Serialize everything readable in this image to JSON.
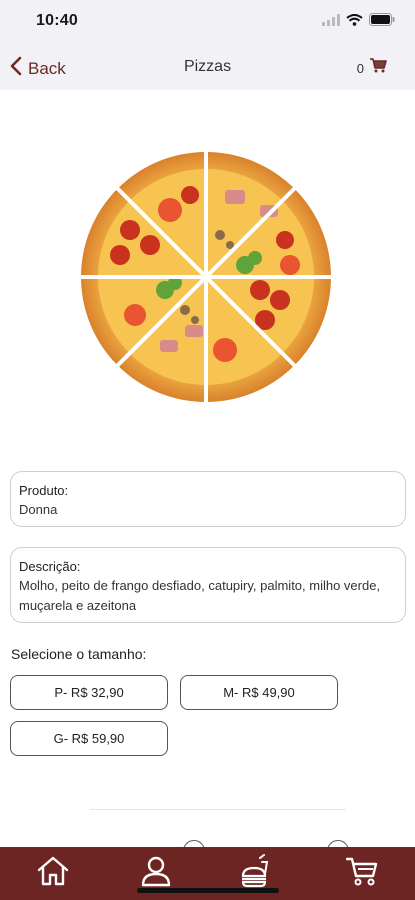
{
  "status": {
    "time": "10:40"
  },
  "nav": {
    "back_label": "Back",
    "title": "Pizzas",
    "cart_count": "0"
  },
  "product": {
    "label": "Produto:",
    "value": "Donna"
  },
  "description": {
    "label": "Descrição:",
    "value": "Molho, peito de frango desfiado, catupiry, palmito, milho verde, muçarela e azeitona"
  },
  "sizes": {
    "heading": "Selecione o tamanho:",
    "options": [
      {
        "label": "P- R$ 32,90"
      },
      {
        "label": "M- R$ 49,90"
      },
      {
        "label": "G- R$ 59,90"
      }
    ]
  },
  "tabs": [
    {
      "icon": "home-icon"
    },
    {
      "icon": "user-icon"
    },
    {
      "icon": "burger-drink-icon"
    },
    {
      "icon": "cart-icon"
    }
  ],
  "colors": {
    "brand": "#6d2523",
    "accent": "#6b2a26",
    "nav_bg": "#f2f2f6"
  }
}
